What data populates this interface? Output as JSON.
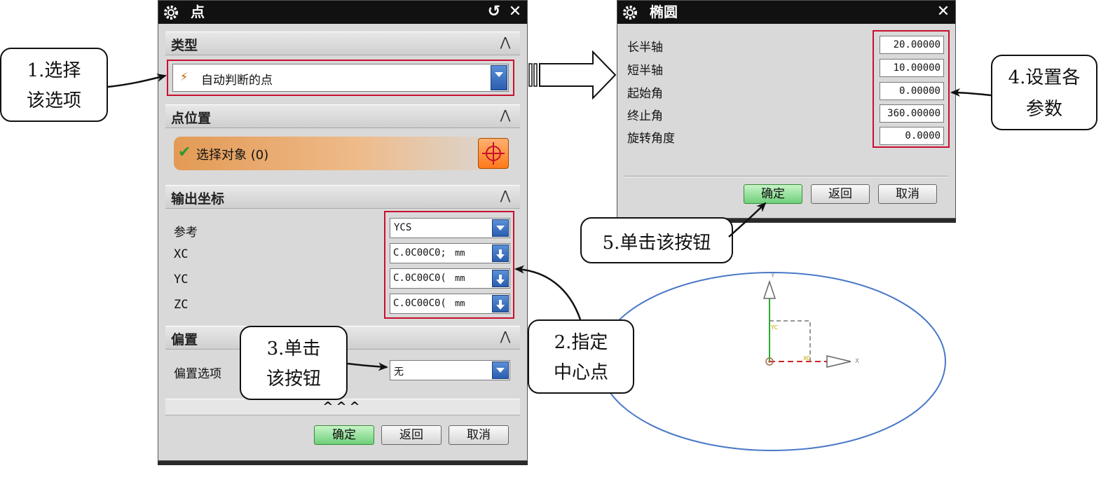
{
  "point_dialog": {
    "title": "点",
    "sections": {
      "type": "类型",
      "point_location": "点位置",
      "output_coords": "输出坐标",
      "offset": "偏置"
    },
    "type_value": "自动判断的点",
    "select_object": "选择对象 (0)",
    "reference_label": "参考",
    "reference_value": "YCS",
    "xc_label": "XC",
    "yc_label": "YC",
    "zc_label": "ZC",
    "xc_value": "C.0C00C0;",
    "yc_value": "C.0C00C0(",
    "zc_value": "C.0C00C0(",
    "unit": "mm",
    "offset_option_label": "偏置选项",
    "offset_option_value": "无",
    "more": "^^^",
    "buttons": {
      "ok": "确定",
      "back": "返回",
      "cancel": "取消"
    }
  },
  "ellipse_dialog": {
    "title": "椭圆",
    "params": [
      {
        "label": "长半轴",
        "value": "20.00000"
      },
      {
        "label": "短半轴",
        "value": "10.00000"
      },
      {
        "label": "起始角",
        "value": "0.00000"
      },
      {
        "label": "终止角",
        "value": "360.00000"
      },
      {
        "label": "旋转角度",
        "value": "0.0000"
      }
    ],
    "buttons": {
      "ok": "确定",
      "back": "返回",
      "cancel": "取消"
    }
  },
  "callouts": {
    "c1": [
      "1.选择",
      "该选项"
    ],
    "c2": [
      "2.指定",
      "中心点"
    ],
    "c3": [
      "3.单击",
      "该按钮"
    ],
    "c4": [
      "4.设置各",
      "参数"
    ],
    "c5": "5.单击该按钮"
  },
  "axes": {
    "x": "X",
    "y": "Y",
    "xc": "XC",
    "yc": "YC"
  },
  "colors": {
    "highlight": "#c8102e",
    "ellipse": "#4a78c8",
    "ok_button": "#6fcf7a"
  }
}
